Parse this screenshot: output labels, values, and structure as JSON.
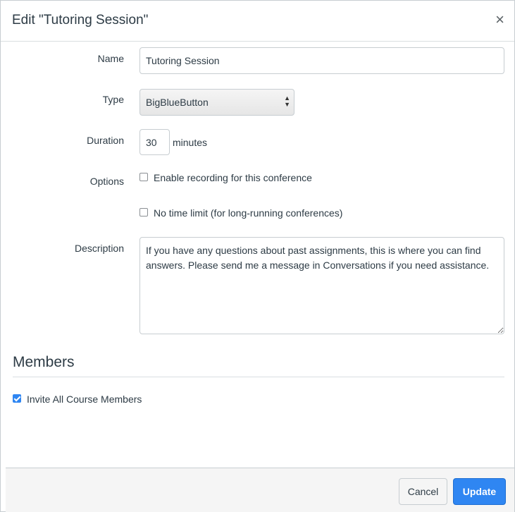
{
  "dialog": {
    "title": "Edit \"Tutoring Session\"",
    "close_glyph": "×"
  },
  "form": {
    "name": {
      "label": "Name",
      "value": "Tutoring Session"
    },
    "type": {
      "label": "Type",
      "value": "BigBlueButton",
      "arrows": "▲▼"
    },
    "duration": {
      "label": "Duration",
      "value": "30",
      "unit": "minutes"
    },
    "options": {
      "label": "Options",
      "enable_recording": {
        "label": "Enable recording for this conference",
        "checked": false
      },
      "no_time_limit": {
        "label": "No time limit (for long-running conferences)",
        "checked": false
      }
    },
    "description": {
      "label": "Description",
      "value": "If you have any questions about past assignments, this is where you can find answers. Please send me a message in Conversations if you need assistance."
    }
  },
  "members": {
    "title": "Members",
    "invite_all": {
      "label": "Invite All Course Members",
      "checked": true
    }
  },
  "footer": {
    "cancel_label": "Cancel",
    "update_label": "Update"
  },
  "colors": {
    "primary": "#2f86f2",
    "text": "#2d3b45",
    "border": "#c7cdd1",
    "footer_bg": "#f5f5f5"
  }
}
